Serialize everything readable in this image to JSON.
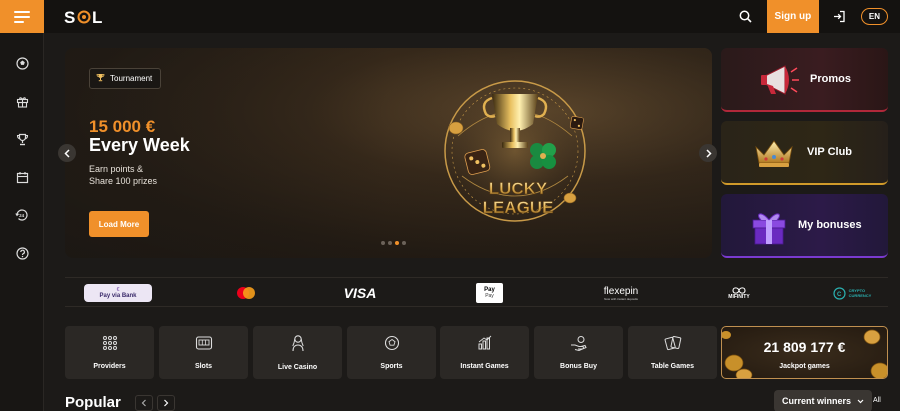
{
  "header": {
    "logo_text": "SOL",
    "signup_label": "Sign up",
    "language": "EN",
    "icons": [
      "menu-icon",
      "search-icon",
      "login-icon"
    ]
  },
  "sidebar": {
    "icons": [
      "sports-ball-icon",
      "gift-icon",
      "trophy-icon",
      "calendar-icon",
      "support-24-icon",
      "help-icon"
    ]
  },
  "hero": {
    "tag": "Tournament",
    "amount": "15 000 €",
    "headline": "Every Week",
    "desc_line1": "Earn points &",
    "desc_line2": "Share 100 prizes",
    "button": "Load More",
    "art_line1": "LUCKY",
    "art_line2": "LEAGUE",
    "slides": 4,
    "active_slide": 3
  },
  "promos": [
    {
      "label": "Promos",
      "icon": "megaphone-icon"
    },
    {
      "label": "VIP Club",
      "icon": "crown-icon"
    },
    {
      "label": "My bonuses",
      "icon": "gift-box-icon"
    }
  ],
  "payments": {
    "paybybank": "Pay via Bank",
    "mastercard": "mastercard",
    "visa": "VISA",
    "applepay_top": "Pay",
    "applepay_bottom": "Pay",
    "flexepin": "flexepin",
    "flexepin_sub": "Now with instant deposits",
    "mifinity": "MIFINITY",
    "crypto_line1": "CRYPTO",
    "crypto_line2": "CURRENCY"
  },
  "categories": [
    {
      "label": "Providers",
      "icon": "grid-dots-icon"
    },
    {
      "label": "Slots",
      "icon": "slot-machine-icon"
    },
    {
      "label": "Live Casino",
      "icon": "dealer-icon"
    },
    {
      "label": "Sports",
      "icon": "ball-icon"
    },
    {
      "label": "Instant Games",
      "icon": "chart-bars-icon"
    },
    {
      "label": "Bonus Buy",
      "icon": "hand-coin-icon"
    },
    {
      "label": "Table Games",
      "icon": "cards-icon"
    }
  ],
  "jackpot": {
    "amount": "21 809 177 €",
    "label": "Jackpot games"
  },
  "bottom": {
    "popular": "Popular",
    "winners": "Current winners",
    "all": "All"
  },
  "colors": {
    "accent": "#f0902a",
    "background": "#1c1a18",
    "card": "#2b2825"
  }
}
